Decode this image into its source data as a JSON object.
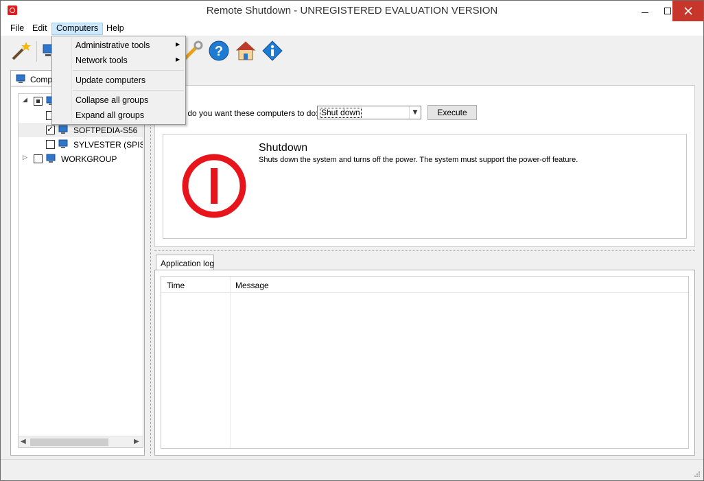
{
  "window": {
    "title": "Remote Shutdown - UNREGISTERED EVALUATION VERSION"
  },
  "menubar": {
    "items": [
      {
        "label": "File"
      },
      {
        "label": "Edit"
      },
      {
        "label": "Computers",
        "open": true
      },
      {
        "label": "Help"
      }
    ]
  },
  "computers_menu": {
    "items": [
      {
        "label": "Administrative tools",
        "submenu": true
      },
      {
        "label": "Network tools",
        "submenu": true
      },
      {
        "label": "Update computers"
      },
      {
        "label": "Collapse all groups"
      },
      {
        "label": "Expand all groups"
      }
    ]
  },
  "toolbar": {
    "icons": [
      "wizard-icon",
      "computer-icon",
      "tools-icon",
      "help-icon",
      "home-icon",
      "info-icon"
    ]
  },
  "left_panel": {
    "tab_label": "Compu",
    "tree": [
      {
        "label": "",
        "checkbox": "indeterminate",
        "expanded": true,
        "level": 0
      },
      {
        "label": "",
        "checkbox": "unchecked",
        "level": 1
      },
      {
        "label": "SOFTPEDIA-S56",
        "checkbox": "checked",
        "level": 1,
        "selected": true
      },
      {
        "label": "SYLVESTER (SPIS",
        "checkbox": "unchecked",
        "level": 1
      },
      {
        "label": "WORKGROUP",
        "checkbox": "unchecked",
        "expanded": false,
        "level": 0
      }
    ]
  },
  "action": {
    "prompt": "at do you want these computers to do:",
    "selected": "Shut down",
    "execute_label": "Execute"
  },
  "info": {
    "title": "Shutdown",
    "description": "Shuts down the system and turns off the power. The system must support the power-off feature.",
    "icon_color": "#e8141b"
  },
  "log": {
    "tab_label": "Application log",
    "columns": [
      "Time",
      "Message"
    ],
    "rows": []
  },
  "colors": {
    "close_button": "#c7362a",
    "menu_highlight": "#cce8ff"
  }
}
